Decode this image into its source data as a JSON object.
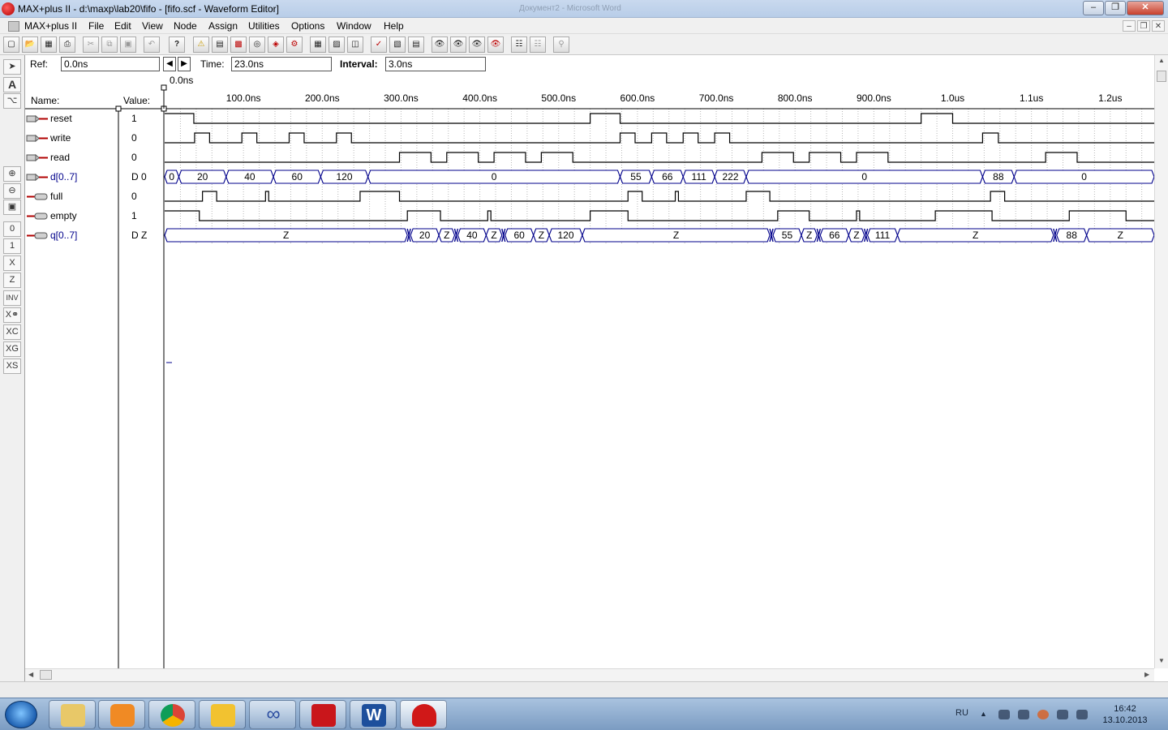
{
  "window": {
    "title": "MAX+plus II - d:\\maxp\\lab20\\fifo - [fifo.scf - Waveform Editor]",
    "background_title": "Документ2 - Microsoft Word"
  },
  "menu": {
    "app_label": "MAX+plus II",
    "items": [
      "File",
      "Edit",
      "View",
      "Node",
      "Assign",
      "Utilities",
      "Options",
      "Window",
      "Help"
    ]
  },
  "header": {
    "ref_label": "Ref:",
    "ref_value": "0.0ns",
    "time_label": "Time:",
    "time_value": "23.0ns",
    "interval_label": "Interval:",
    "interval_value": "3.0ns",
    "cursor_label": "0.0ns",
    "name_col": "Name:",
    "value_col": "Value:"
  },
  "time_axis": {
    "unit": "ns",
    "ticks": [
      {
        "t": 100,
        "label": "100.0ns"
      },
      {
        "t": 200,
        "label": "200.0ns"
      },
      {
        "t": 300,
        "label": "300.0ns"
      },
      {
        "t": 400,
        "label": "400.0ns"
      },
      {
        "t": 500,
        "label": "500.0ns"
      },
      {
        "t": 600,
        "label": "600.0ns"
      },
      {
        "t": 700,
        "label": "700.0ns"
      },
      {
        "t": 800,
        "label": "800.0ns"
      },
      {
        "t": 900,
        "label": "900.0ns"
      },
      {
        "t": 1000,
        "label": "1.0us"
      },
      {
        "t": 1100,
        "label": "1.1us"
      },
      {
        "t": 1200,
        "label": "1.2us"
      }
    ]
  },
  "signals": [
    {
      "name": "reset",
      "value": "1",
      "dir": "input",
      "kind": "bit",
      "color": "#000000",
      "waveform": [
        [
          0,
          1
        ],
        [
          37,
          0
        ],
        [
          540,
          1
        ],
        [
          578,
          0
        ],
        [
          960,
          1
        ],
        [
          1000,
          0
        ]
      ]
    },
    {
      "name": "write",
      "value": "0",
      "dir": "input",
      "kind": "bit",
      "color": "#000000",
      "waveform": [
        [
          0,
          0
        ],
        [
          38,
          1
        ],
        [
          57,
          0
        ],
        [
          98,
          1
        ],
        [
          117,
          0
        ],
        [
          158,
          1
        ],
        [
          177,
          0
        ],
        [
          218,
          1
        ],
        [
          237,
          0
        ],
        [
          578,
          1
        ],
        [
          597,
          0
        ],
        [
          618,
          1
        ],
        [
          637,
          0
        ],
        [
          658,
          1
        ],
        [
          677,
          0
        ],
        [
          698,
          1
        ],
        [
          717,
          0
        ],
        [
          1038,
          1
        ],
        [
          1058,
          0
        ]
      ]
    },
    {
      "name": "read",
      "value": "0",
      "dir": "input",
      "kind": "bit",
      "color": "#000000",
      "waveform": [
        [
          0,
          0
        ],
        [
          298,
          1
        ],
        [
          338,
          0
        ],
        [
          358,
          1
        ],
        [
          398,
          0
        ],
        [
          418,
          1
        ],
        [
          458,
          0
        ],
        [
          478,
          1
        ],
        [
          518,
          0
        ],
        [
          758,
          1
        ],
        [
          798,
          0
        ],
        [
          818,
          1
        ],
        [
          858,
          0
        ],
        [
          878,
          1
        ],
        [
          918,
          0
        ],
        [
          1118,
          1
        ],
        [
          1158,
          0
        ]
      ]
    },
    {
      "name": "d[0..7]",
      "value": "D 0",
      "dir": "input",
      "kind": "bus",
      "color": "#00008b",
      "segments": [
        [
          0,
          "0"
        ],
        [
          18,
          "20"
        ],
        [
          78,
          "40"
        ],
        [
          138,
          "60"
        ],
        [
          198,
          "120"
        ],
        [
          258,
          "0"
        ],
        [
          578,
          "55"
        ],
        [
          618,
          "66"
        ],
        [
          658,
          "111"
        ],
        [
          698,
          "222"
        ],
        [
          738,
          "0"
        ],
        [
          1038,
          "88"
        ],
        [
          1078,
          "0"
        ]
      ]
    },
    {
      "name": "full",
      "value": "0",
      "dir": "output",
      "kind": "bit",
      "color": "#000000",
      "waveform": [
        [
          0,
          0
        ],
        [
          48,
          1
        ],
        [
          66,
          0
        ],
        [
          128,
          1
        ],
        [
          132,
          0
        ],
        [
          248,
          1
        ],
        [
          298,
          0
        ],
        [
          588,
          1
        ],
        [
          606,
          0
        ],
        [
          648,
          1
        ],
        [
          652,
          0
        ],
        [
          738,
          1
        ],
        [
          768,
          0
        ],
        [
          1048,
          1
        ],
        [
          1066,
          0
        ]
      ]
    },
    {
      "name": "empty",
      "value": "1",
      "dir": "output",
      "kind": "bit",
      "color": "#000000",
      "waveform": [
        [
          0,
          1
        ],
        [
          44,
          0
        ],
        [
          308,
          1
        ],
        [
          350,
          0
        ],
        [
          410,
          1
        ],
        [
          414,
          0
        ],
        [
          540,
          1
        ],
        [
          588,
          0
        ],
        [
          778,
          1
        ],
        [
          818,
          0
        ],
        [
          878,
          1
        ],
        [
          882,
          0
        ],
        [
          978,
          1
        ],
        [
          1050,
          0
        ],
        [
          1148,
          1
        ],
        [
          1220,
          0
        ]
      ]
    },
    {
      "name": "q[0..7]",
      "value": "D Z",
      "dir": "output",
      "kind": "bus",
      "color": "#00008b",
      "segments": [
        [
          0,
          "Z"
        ],
        [
          308,
          "X"
        ],
        [
          312,
          "20"
        ],
        [
          348,
          "Z"
        ],
        [
          368,
          "X"
        ],
        [
          372,
          "40"
        ],
        [
          408,
          "Z"
        ],
        [
          428,
          "X"
        ],
        [
          432,
          "60"
        ],
        [
          468,
          "Z"
        ],
        [
          488,
          "120"
        ],
        [
          530,
          "Z"
        ],
        [
          768,
          "X"
        ],
        [
          772,
          "55"
        ],
        [
          808,
          "Z"
        ],
        [
          828,
          "X"
        ],
        [
          832,
          "66"
        ],
        [
          868,
          "Z"
        ],
        [
          888,
          "X"
        ],
        [
          892,
          "111"
        ],
        [
          930,
          "Z"
        ],
        [
          1128,
          "X"
        ],
        [
          1132,
          "88"
        ],
        [
          1170,
          "Z"
        ]
      ]
    }
  ],
  "taskbar": {
    "language": "RU",
    "time": "16:42",
    "date": "13.10.2013"
  }
}
